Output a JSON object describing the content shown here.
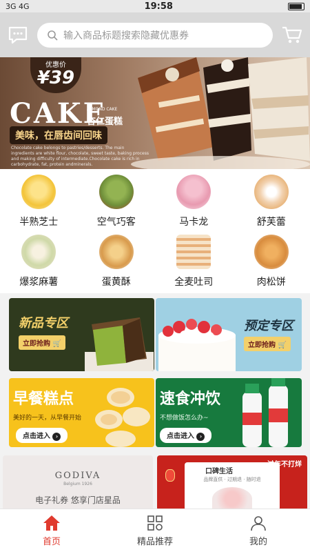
{
  "status": {
    "left": "3G 4G",
    "time": "19:58"
  },
  "search": {
    "placeholder": "输入商品标题搜索隐藏优惠券"
  },
  "banner": {
    "price_tag": "优惠价",
    "price": "¥39",
    "headline": "CAKE",
    "brand_en": "ALMOND CAKE",
    "brand_cn": "杏仁蛋糕",
    "slogan": "美味，在唇齿间回味",
    "description": "Chocolate cake belongs to pastries/desserts. The main ingredients are white flour, chocolate, sweet taste, baking process and making difficulty of intermediate.Chocolate cake is rich in carbohydrate, fat, protein andminerals."
  },
  "categories": [
    {
      "label": "半熟芝士",
      "icon": "cheese-tart-icon",
      "color": "#f3c43a"
    },
    {
      "label": "空气巧客",
      "icon": "matcha-ball-icon",
      "color": "#6f8f3a"
    },
    {
      "label": "马卡龙",
      "icon": "macaron-icon",
      "color": "#e89ab0"
    },
    {
      "label": "舒芙蕾",
      "icon": "souffle-icon",
      "color": "#f2d2b0"
    },
    {
      "label": "爆浆麻薯",
      "icon": "mochi-icon",
      "color": "#cfd9a8"
    },
    {
      "label": "蛋黄酥",
      "icon": "egg-yolk-pastry-icon",
      "color": "#d89a4c"
    },
    {
      "label": "全麦吐司",
      "icon": "toast-icon",
      "color": "#e8b07a"
    },
    {
      "label": "肉松饼",
      "icon": "meat-floss-cake-icon",
      "color": "#d88c3e"
    }
  ],
  "promos": {
    "new": {
      "title": "新品专区",
      "button": "立即抢购"
    },
    "preorder": {
      "title": "预定专区",
      "button": "立即抢购"
    },
    "breakfast": {
      "title": "早餐糕点",
      "subtitle": "美好的一天，从早餐开始",
      "button": "点击进入"
    },
    "drinks": {
      "title": "速食冲饮",
      "subtitle": "不想做饭怎么办~",
      "button": "点击进入"
    },
    "godiva": {
      "brand": "GODIVA",
      "brand_sub": "Belgium 1926",
      "text": "电子礼券 悠享门店星品"
    },
    "koubei": {
      "brand": "口碑生活",
      "badge": "过年不打烊",
      "sub": "品牌直供 · 过期退 · 随时退"
    }
  },
  "nav": [
    {
      "label": "首页",
      "icon": "home-icon"
    },
    {
      "label": "精品推荐",
      "icon": "grid-icon"
    },
    {
      "label": "我的",
      "icon": "user-icon"
    }
  ],
  "colors": {
    "accent": "#e03a2e",
    "dark_green": "#2f3a1e",
    "sky_blue": "#9fd0e3",
    "yellow": "#f7c21c",
    "green": "#177a3e"
  }
}
